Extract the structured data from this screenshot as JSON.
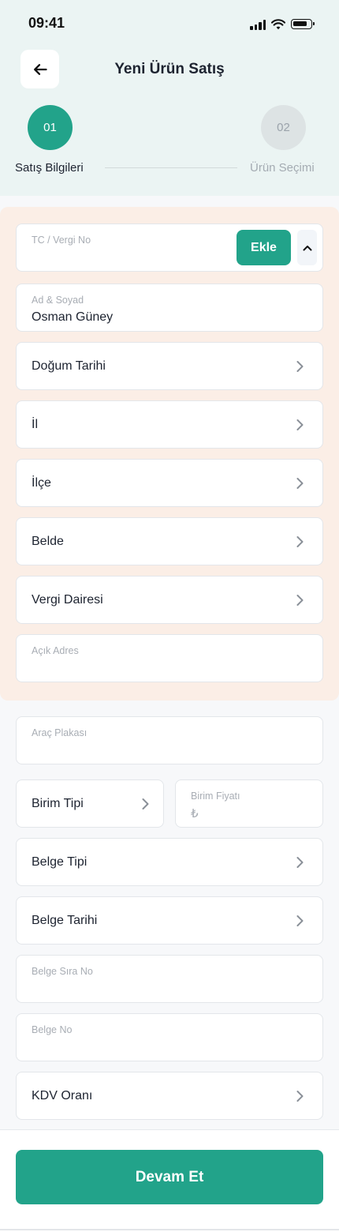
{
  "status_bar": {
    "time": "09:41"
  },
  "header": {
    "title": "Yeni Ürün Satış"
  },
  "steps": [
    {
      "number": "01",
      "label": "Satış Bilgileri",
      "active": true
    },
    {
      "number": "02",
      "label": "Ürün Seçimi",
      "active": false
    }
  ],
  "customer": {
    "tc_placeholder": "TC / Vergi No",
    "add_button": "Ekle",
    "name_placeholder": "Ad & Soyad",
    "name_value": "Osman Güney",
    "birth_date_label": "Doğum Tarihi",
    "province_label": "İl",
    "district_label": "İlçe",
    "town_label": "Belde",
    "tax_office_label": "Vergi Dairesi",
    "address_placeholder": "Açık Adres"
  },
  "sale": {
    "plate_placeholder": "Araç Plakası",
    "unit_type_label": "Birim Tipi",
    "unit_price_placeholder": "Birim Fiyatı",
    "currency_symbol": "₺",
    "document_type_label": "Belge Tipi",
    "document_date_label": "Belge Tarihi",
    "document_seq_placeholder": "Belge Sıra No",
    "document_no_placeholder": "Belge No",
    "vat_rate_label": "KDV Oranı"
  },
  "footer": {
    "continue_button": "Devam Et"
  },
  "colors": {
    "accent": "#22a38a",
    "peach_bg": "#fbeee6",
    "header_bg": "#ebf4f3"
  },
  "icons": {
    "back": "arrow-left-icon",
    "collapse": "chevron-up-icon",
    "row": "chevron-right-icon"
  }
}
